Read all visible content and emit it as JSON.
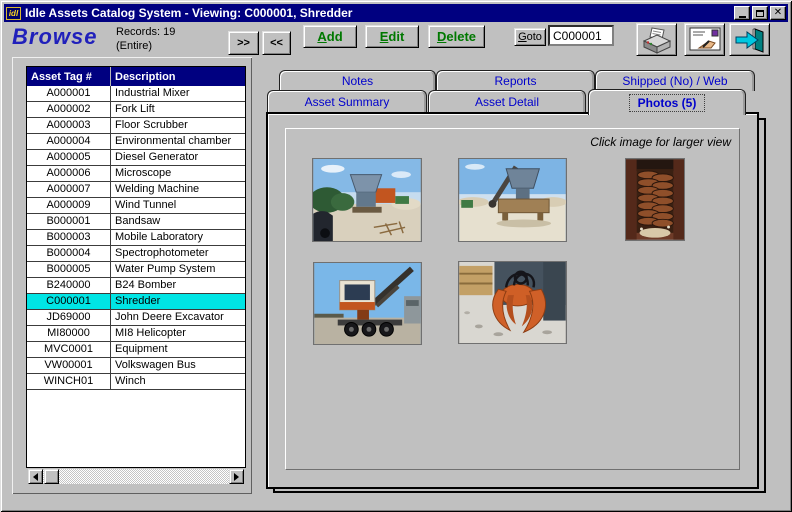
{
  "window": {
    "title": "Idle Assets Catalog System - Viewing: C000001, Shredder",
    "icon_label": "idl",
    "controls": {
      "minimize": "minimize",
      "maximize": "maximize",
      "close": "close"
    }
  },
  "toolbar": {
    "browse_label": "Browse",
    "records_line1": "Records: 19",
    "records_line2": "(Entire)",
    "next_label": ">>",
    "prev_label": "<<",
    "add_label": "Add",
    "edit_label": "Edit",
    "delete_label": "Delete",
    "goto_label": "Goto",
    "goto_value": "C000001",
    "icon_buttons": [
      "print-icon",
      "mail-report-icon",
      "exit-icon"
    ]
  },
  "asset_table": {
    "columns": [
      "Asset Tag #",
      "Description"
    ],
    "selected_tag": "C000001",
    "rows": [
      [
        "A000001",
        "Industrial Mixer"
      ],
      [
        "A000002",
        "Fork Lift"
      ],
      [
        "A000003",
        "Floor Scrubber"
      ],
      [
        "A000004",
        "Environmental chamber"
      ],
      [
        "A000005",
        "Diesel Generator"
      ],
      [
        "A000006",
        "Microscope"
      ],
      [
        "A000007",
        "Welding Machine"
      ],
      [
        "A000009",
        "Wind Tunnel"
      ],
      [
        "B000001",
        "Bandsaw"
      ],
      [
        "B000003",
        "Mobile Laboratory"
      ],
      [
        "B000004",
        "Spectrophotometer"
      ],
      [
        "B000005",
        "Water Pump System"
      ],
      [
        "B240000",
        "B24 Bomber"
      ],
      [
        "C000001",
        "Shredder"
      ],
      [
        "JD69000",
        "John Deere Excavator"
      ],
      [
        "MI80000",
        "MI8 Helicopter"
      ],
      [
        "MVC0001",
        "Equipment"
      ],
      [
        "VW00001",
        "Volkswagen Bus"
      ],
      [
        "WINCH01",
        "Winch"
      ]
    ]
  },
  "tabs": {
    "top_row": [
      "Notes",
      "Reports",
      "Shipped (No) / Web"
    ],
    "bottom_row": [
      "Asset Summary",
      "Asset Detail",
      "Photos (5)"
    ],
    "active": "Photos (5)"
  },
  "photos_page": {
    "hint": "Click image for larger view",
    "photos": [
      {
        "name": "shredder-plant-side-view"
      },
      {
        "name": "shredder-with-conveyor"
      },
      {
        "name": "shredder-rotor-closeup"
      },
      {
        "name": "wheeled-log-loader"
      },
      {
        "name": "orange-grapple-claw"
      }
    ]
  },
  "colors": {
    "titlebar": "#000080",
    "table_header": "#000080",
    "selected_row": "#00e5e5",
    "action_button_text": "#007800",
    "tab_text": "#0000cc",
    "browse_text": "#2020bb"
  }
}
